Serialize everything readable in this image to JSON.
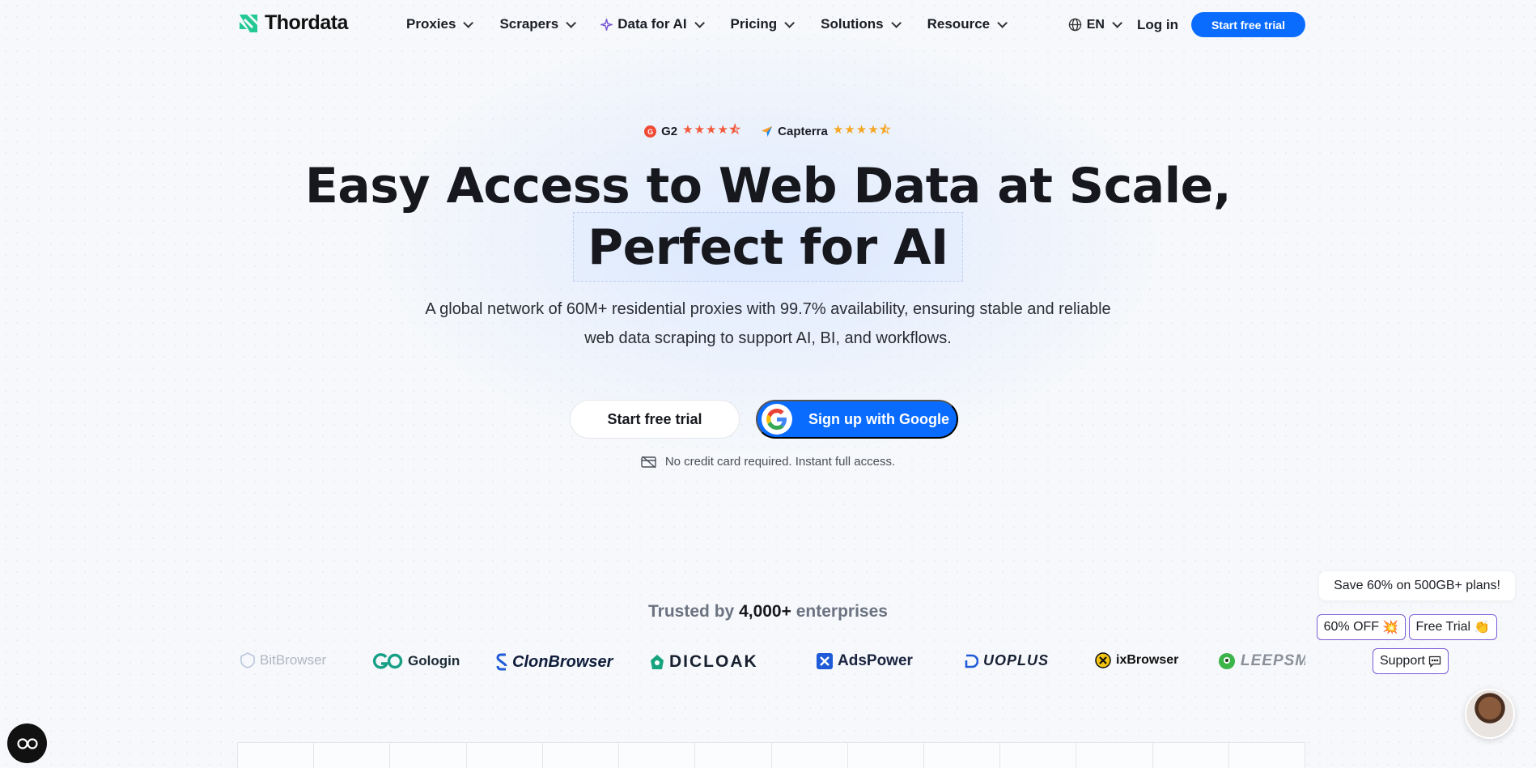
{
  "nav": {
    "logo": "Thordata",
    "menu": [
      {
        "label": "Proxies"
      },
      {
        "label": "Scrapers"
      },
      {
        "label": "Data for AI"
      },
      {
        "label": "Pricing"
      },
      {
        "label": "Solutions"
      },
      {
        "label": "Resource"
      }
    ],
    "lang": "EN",
    "login": "Log in",
    "cta": "Start free trial"
  },
  "ratings": {
    "g2": {
      "label": "G2",
      "stars": 4.5
    },
    "capterra": {
      "label": "Capterra",
      "stars": 4.5
    }
  },
  "hero": {
    "title_line1": "Easy Access to Web Data at Scale,",
    "title_line2": "Perfect for AI",
    "subtitle_line1": "A global network of 60M+ residential proxies with 99.7% availability, ensuring stable and reliable",
    "subtitle_line2": "web data scraping to support AI, BI, and workflows.",
    "btn_trial": "Start free trial",
    "btn_google": "Sign up with Google",
    "no_card": "No credit card required. Instant full access."
  },
  "trusted": {
    "prefix": "Trusted by",
    "count": "4,000+",
    "suffix": "enterprises",
    "brands": [
      "BitBrowser",
      "Gologin",
      "ClonBrowser",
      "DICLOAK",
      "AdsPower",
      "UOPLUS",
      "ixBrowser",
      "LEEPSMA"
    ]
  },
  "floating": {
    "promo": "Save 60% on 500GB+ plans!",
    "chip_off": "60% OFF",
    "chip_trial": "Free Trial",
    "chip_support": "Support"
  },
  "colors": {
    "accent": "#0a6cff",
    "logo_green": "#22c993",
    "chip_border": "#7b5cd6"
  }
}
